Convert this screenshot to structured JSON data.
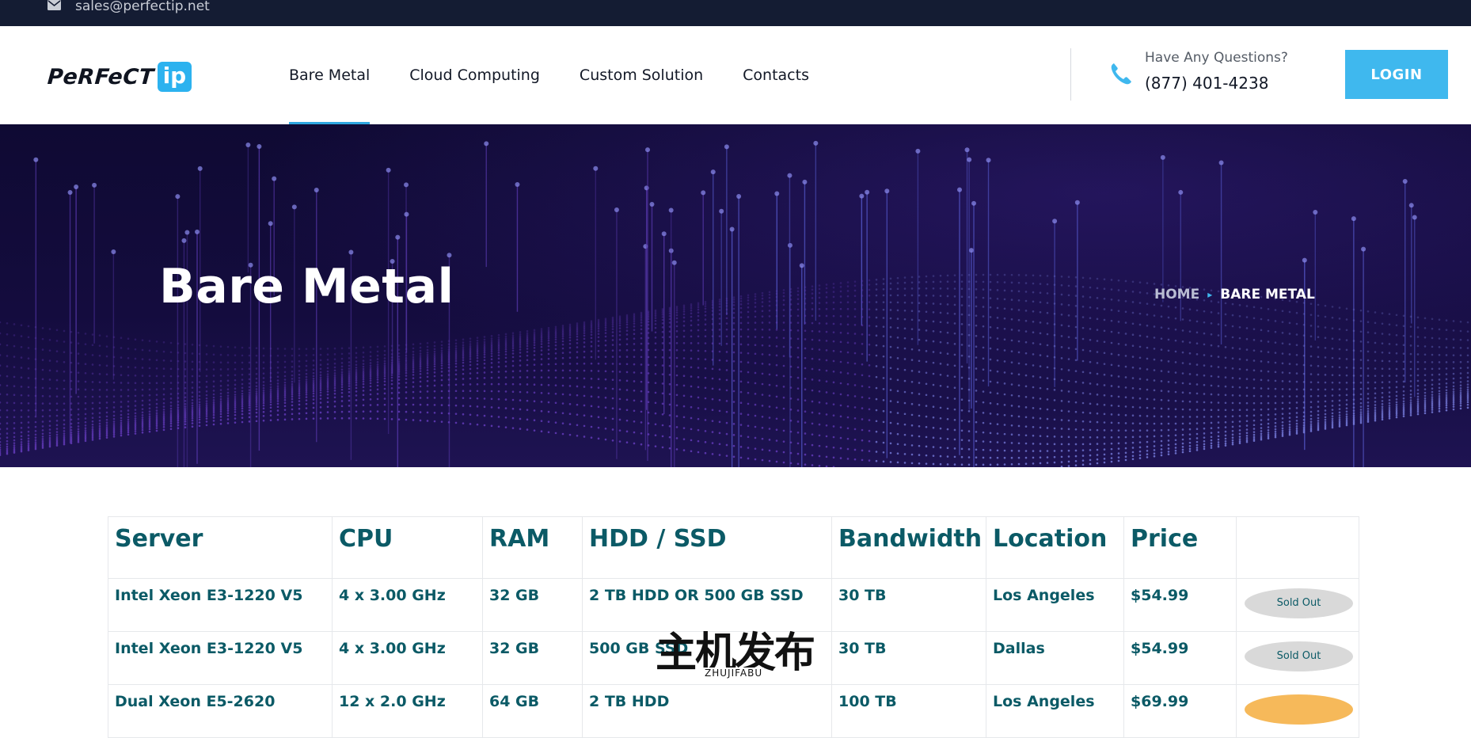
{
  "topbar": {
    "email": "sales@perfectip.net",
    "email_icon": "envelope-icon"
  },
  "header": {
    "logo_word": "PeRFeCT",
    "logo_badge": "ip",
    "nav": [
      {
        "label": "Bare Metal",
        "active": true
      },
      {
        "label": "Cloud Computing"
      },
      {
        "label": "Custom Solution"
      },
      {
        "label": "Contacts"
      }
    ],
    "question_label": "Have Any Questions?",
    "phone": "(877) 401-4238",
    "phone_icon": "phone-icon",
    "login": "LOGIN"
  },
  "hero": {
    "title": "Bare Metal",
    "breadcrumb": {
      "home": "HOME",
      "separator": "▸",
      "current": "BARE METAL"
    }
  },
  "table": {
    "headers": [
      "Server",
      "CPU",
      "RAM",
      "HDD / SSD",
      "Bandwidth",
      "Location",
      "Price",
      ""
    ],
    "rows": [
      {
        "server": "Intel Xeon E3-1220 V5",
        "cpu": "4 x 3.00 GHz",
        "ram": "32 GB",
        "disk": "2 TB HDD OR 500 GB SSD",
        "bandwidth": "30 TB",
        "location": "Los Angeles",
        "price": "$54.99",
        "status": "Sold Out"
      },
      {
        "server": "Intel Xeon E3-1220 V5",
        "cpu": "4 x 3.00 GHz",
        "ram": "32 GB",
        "disk": "500 GB SSD",
        "bandwidth": "30 TB",
        "location": "Dallas",
        "price": "$54.99",
        "status": "Sold Out"
      },
      {
        "server": "Dual Xeon E5-2620",
        "cpu": "12 x 2.0 GHz",
        "ram": "64 GB",
        "disk": "2 TB HDD",
        "bandwidth": "100 TB",
        "location": "Los Angeles",
        "price": "$69.99",
        "status": ""
      }
    ]
  },
  "watermark": {
    "main": "主机发布",
    "sub": "ZHUJIFABU"
  },
  "colors": {
    "accent": "#3fb8ee",
    "heading": "#0b5a66",
    "topbar": "#141c33",
    "hero": "#140c3e"
  }
}
